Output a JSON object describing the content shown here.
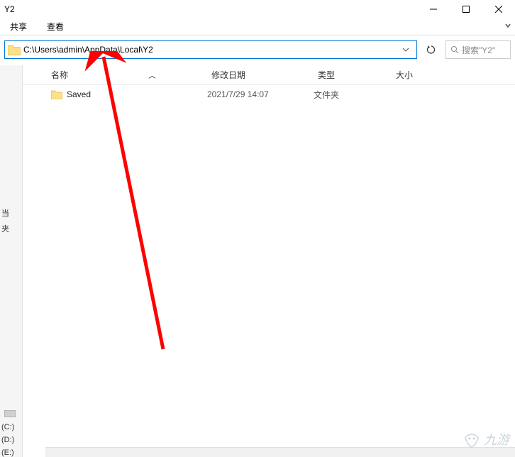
{
  "window": {
    "title": "Y2"
  },
  "tabs": {
    "share": "共享",
    "view": "查看"
  },
  "address": {
    "path": "C:\\Users\\admin\\AppData\\Local\\Y2",
    "search_placeholder": "搜索\"Y2\""
  },
  "columns": {
    "name": "名称",
    "date": "修改日期",
    "type": "类型",
    "size": "大小"
  },
  "files": [
    {
      "name": "Saved",
      "date": "2021/7/29 14:07",
      "type": "文件夹"
    }
  ],
  "sidebar": {
    "label_line1": "当",
    "label_line2": "夹",
    "drives": {
      "c": "(C:)",
      "d": "(D:)",
      "e": "(E:)"
    }
  },
  "watermark": {
    "text": "九游"
  }
}
